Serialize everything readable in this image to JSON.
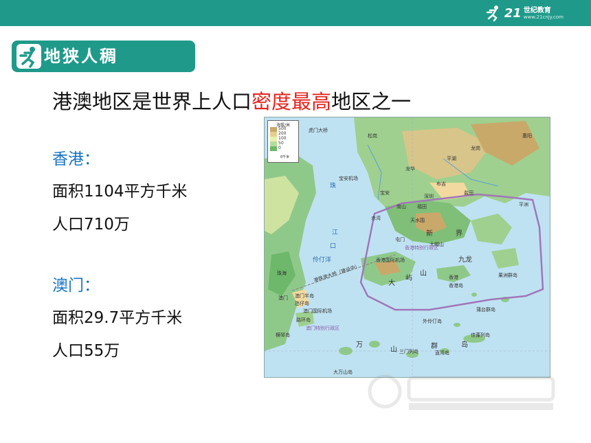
{
  "header": {
    "logo_number": "21",
    "logo_name": "世纪教育",
    "logo_url": "www.21cnjy.com"
  },
  "section": {
    "title": "地狭人稠"
  },
  "headline": {
    "part1": "港澳地区是世界上人口",
    "highlight": "密度最高",
    "part2": "地区之一"
  },
  "hongkong": {
    "title": "香港：",
    "area": "面积1104平方千米",
    "population": "人口710万"
  },
  "macau": {
    "title": "澳门：",
    "area": "面积29.7平方千米",
    "population": "人口55万"
  },
  "map": {
    "legend_title": "海拔/米",
    "legend_levels": [
      "500",
      "200",
      "100",
      "50",
      "0"
    ],
    "legend_scale": "8千米",
    "region_label": "香港特别行政区",
    "macau_region_label": "澳门特别行政区",
    "places": {
      "humen": "虎门大桥",
      "songgang": "松岗",
      "baoan_airport": "宝安机场",
      "baoan": "宝安",
      "longhua": "龙华",
      "shenzhen": "深圳",
      "futian": "福田",
      "nanshan": "南山",
      "chiwan": "赤湾",
      "pingshan": "平湖",
      "buji": "布吉",
      "longgang": "龙岗",
      "huizhou": "惠阳",
      "yantian": "盐田",
      "pingzhou": "平洲",
      "xinjie_1": "新",
      "xinjie_2": "界",
      "tunmen": "屯门",
      "tianshui": "天水围",
      "damao": "大帽山",
      "jiulong": "九龙",
      "hk_airport": "香港国际机场",
      "dayu_1": "大",
      "dayu_2": "屿",
      "dayu_3": "山",
      "hkisland": "香港岛",
      "xianggang": "香港",
      "guozhou": "果洲群岛",
      "putai": "蒲台群岛",
      "wailingding": "外伶仃岛",
      "zhuhai": "珠海",
      "aomen": "澳门",
      "aomen_peninsula": "澳门半岛",
      "taipa": "氹仔岛",
      "macau_airport": "澳门国际机场",
      "luhuan": "路环岛",
      "hengqin": "横琴岛",
      "wan": "万",
      "shan": "山",
      "qun": "群",
      "dao": "岛",
      "sanmen": "三门列岛",
      "zhiwan": "直湾岛",
      "dawanshan": "大万山岛",
      "jiazhou": "佳蓬列岛",
      "bridge": "港珠澳大桥（建设中）",
      "zhu": "珠",
      "jiang": "江",
      "kou": "口",
      "lingding": "伶仃洋"
    }
  },
  "colors": {
    "teal": "#1f9a8a",
    "highlight_red": "#e3231b",
    "subtitle_blue": "#1773c4"
  }
}
